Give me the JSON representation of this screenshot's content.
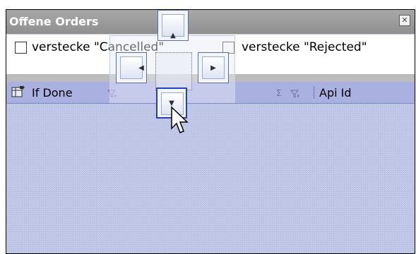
{
  "panel": {
    "title": "Offene Orders",
    "close_glyph": "✕"
  },
  "filters": [
    {
      "label": "verstecke \"Cancelled\"",
      "checked": false
    },
    {
      "label": "verstecke \"Rejected\"",
      "checked": false
    }
  ],
  "grid": {
    "columns": [
      "If Done",
      "Api Id"
    ],
    "sum_glyph": "Σ",
    "filter_glyph": "𝕐"
  },
  "dock_arrows": {
    "top": "▲",
    "left": "◀",
    "right": "▶",
    "bottom": "▼"
  },
  "icons": {
    "column-chooser": "column-chooser-icon",
    "filter": "filter-icon",
    "cursor": "arrow-cursor-icon"
  }
}
